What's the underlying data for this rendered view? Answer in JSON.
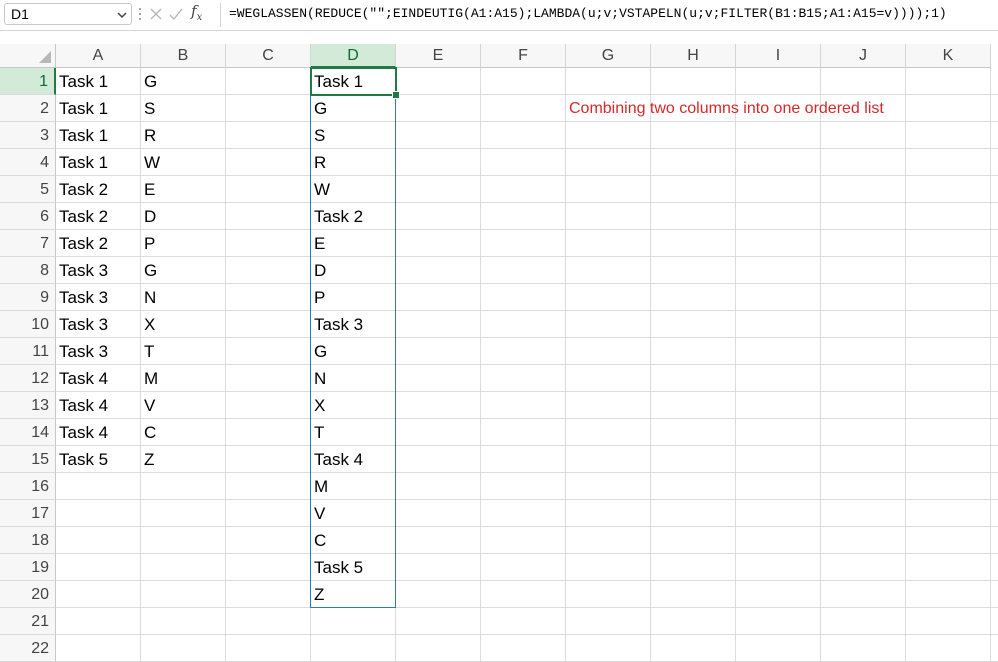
{
  "formula_bar": {
    "name_box": "D1",
    "fx": "f",
    "fx_sub": "x",
    "formula": "=WEGLASSEN(REDUCE(\"\";EINDEUTIG(A1:A15);LAMBDA(u;v;VSTAPELN(u;v;FILTER(B1:B15;A1:A15=v))));1)"
  },
  "columns": [
    "A",
    "B",
    "C",
    "D",
    "E",
    "F",
    "G",
    "H",
    "I",
    "J",
    "K"
  ],
  "selected_column": "D",
  "rows": [
    1,
    2,
    3,
    4,
    5,
    6,
    7,
    8,
    9,
    10,
    11,
    12,
    13,
    14,
    15,
    16,
    17,
    18,
    19,
    20,
    21,
    22
  ],
  "selected_row": 1,
  "column_a": [
    "Task 1",
    "Task 1",
    "Task 1",
    "Task 1",
    "Task 2",
    "Task 2",
    "Task 2",
    "Task 3",
    "Task 3",
    "Task 3",
    "Task 3",
    "Task 4",
    "Task 4",
    "Task 4",
    "Task 5"
  ],
  "column_b": [
    "G",
    "S",
    "R",
    "W",
    "E",
    "D",
    "P",
    "G",
    "N",
    "X",
    "T",
    "M",
    "V",
    "C",
    "Z"
  ],
  "column_d": [
    "Task 1",
    "G",
    "S",
    "R",
    "W",
    "Task 2",
    "E",
    "D",
    "P",
    "Task 3",
    "G",
    "N",
    "X",
    "T",
    "Task 4",
    "M",
    "V",
    "C",
    "Task 5",
    "Z"
  ],
  "note": {
    "text": "Combining two columns into one ordered list",
    "color": "#d42a2a"
  },
  "colors": {
    "selection": "#1f7a44",
    "spill_border": "#2e77c8",
    "header_selected_bg": "#d3ead8"
  }
}
